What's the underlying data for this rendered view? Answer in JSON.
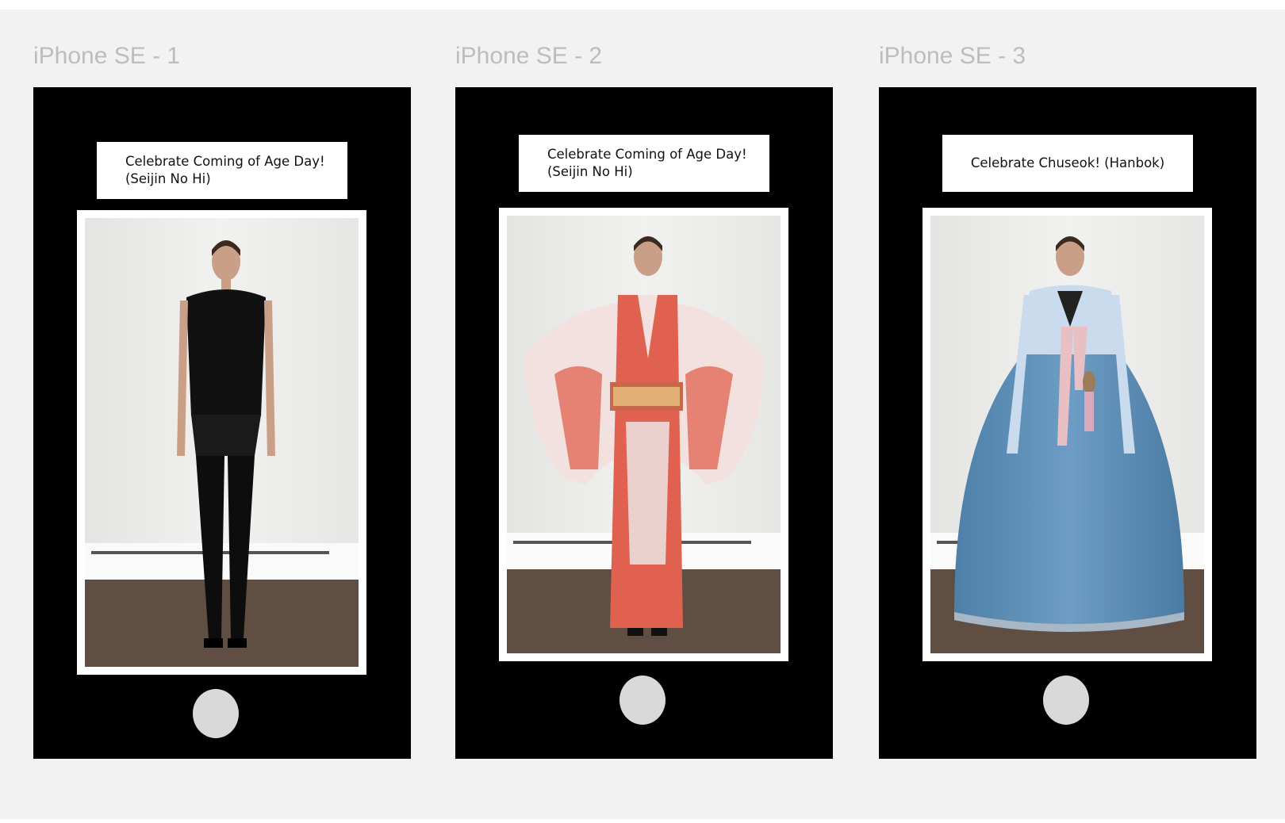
{
  "canvas": {
    "frames": [
      {
        "title": "iPhone SE - 1",
        "caption": "Celebrate Coming of Age Day!\n(Seijin No Hi)",
        "photo": "model-black-outfit",
        "home_button": "home-button"
      },
      {
        "title": "iPhone SE - 2",
        "caption": "Celebrate Coming of Age Day!\n(Seijin No Hi)",
        "photo": "model-kimono",
        "home_button": "home-button"
      },
      {
        "title": "iPhone SE - 3",
        "caption": "Celebrate Chuseok! (Hanbok)",
        "photo": "model-hanbok",
        "home_button": "home-button"
      }
    ]
  },
  "colors": {
    "canvas_background": "#f2f2f2",
    "phone_body": "#000000",
    "frame_label": "#bdbdbd",
    "home_button": "#d9d9d9",
    "kimono": "#e0614f",
    "hanbok_skirt": "#5d8fb8",
    "hanbok_jacket": "#c9dbec"
  }
}
